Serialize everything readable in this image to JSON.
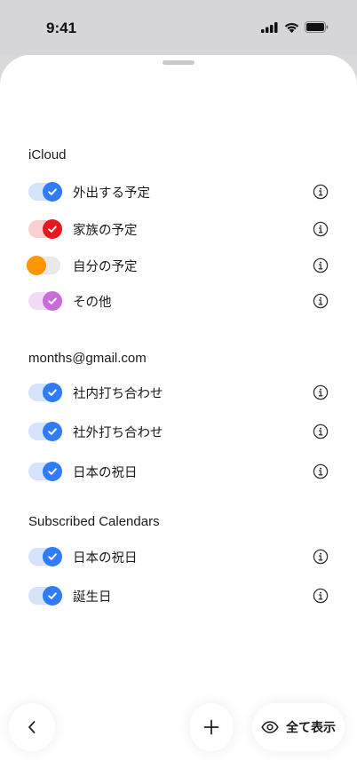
{
  "status_bar": {
    "time": "9:41"
  },
  "sections": [
    {
      "title": "iCloud",
      "items": [
        {
          "label": "外出する予定",
          "on": true,
          "color": "#2f7cf6",
          "track": "#d6e4fb"
        },
        {
          "label": "家族の予定",
          "on": true,
          "color": "#e8161f",
          "track": "#f8d0d2"
        },
        {
          "label": "自分の予定",
          "on": false,
          "color": "#ff9500",
          "track": "#e9e9eb"
        },
        {
          "label": "その他",
          "on": true,
          "color": "#c86dd7",
          "track": "#f2dcf5"
        }
      ]
    },
    {
      "title": "months@gmail.com",
      "items": [
        {
          "label": "社内打ち合わせ",
          "on": true,
          "color": "#2f7cf6",
          "track": "#d6e4fb"
        },
        {
          "label": "社外打ち合わせ",
          "on": true,
          "color": "#2f7cf6",
          "track": "#d6e4fb"
        },
        {
          "label": "日本の祝日",
          "on": true,
          "color": "#2f7cf6",
          "track": "#d6e4fb"
        }
      ]
    },
    {
      "title": "Subscribed Calendars",
      "items": [
        {
          "label": "日本の祝日",
          "on": true,
          "color": "#2f7cf6",
          "track": "#d6e4fb"
        },
        {
          "label": "誕生日",
          "on": true,
          "color": "#2f7cf6",
          "track": "#d6e4fb"
        }
      ]
    }
  ],
  "bottom_bar": {
    "back_icon": "chevron-left-icon",
    "add_icon": "plus-icon",
    "show_all_icon": "eye-icon",
    "show_all_label": "全て表示"
  }
}
